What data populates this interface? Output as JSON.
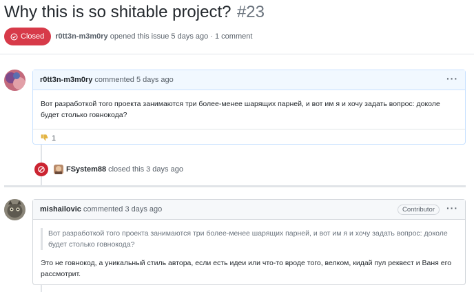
{
  "issue": {
    "title": "Why this is so shitable project?",
    "number": "#23",
    "state": "Closed",
    "author": "r0tt3n-m3m0ry",
    "opened_text": "opened this issue 5 days ago · 1 comment"
  },
  "comments": [
    {
      "author": "r0tt3n-m3m0ry",
      "time_text": "commented 5 days ago",
      "body": "Вот разработкой того проекта занимаются три более-менее шарящих парней, и вот им я и хочу задать вопрос: доколе будет столько говнокода?",
      "reaction_icon": "thumbs-down-icon",
      "reaction_count": "1"
    },
    {
      "author": "mishailovic",
      "time_text": "commented 3 days ago",
      "badge": "Contributor",
      "quote": "Вот разработкой того проекта занимаются три более-менее шарящих парней, и вот им я и хочу задать вопрос: доколе будет столько говнокода?",
      "body": "Это не говнокод, а уникальный стиль автора, если есть идеи или что-то вроде того, велком, кидай пул реквест и Ваня его рассмотрит."
    }
  ],
  "event": {
    "actor": "FSystem88",
    "text": "closed this 3 days ago"
  },
  "colors": {
    "closed": "#d73a49",
    "closed_event": "#cb2431",
    "comment_border": "#c8e1ff",
    "comment_header": "#f1f8ff"
  },
  "kebab": "···"
}
